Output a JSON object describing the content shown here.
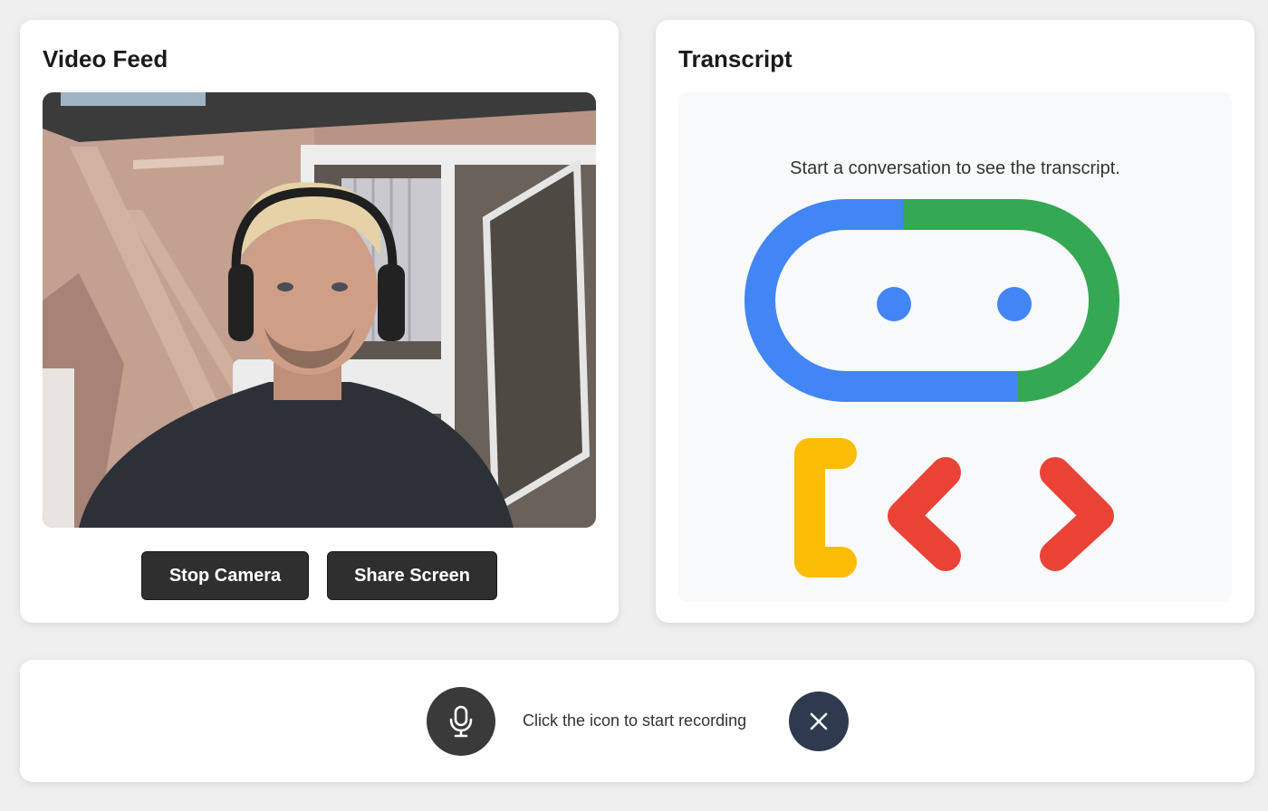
{
  "video": {
    "title": "Video Feed",
    "stop_camera_label": "Stop Camera",
    "share_screen_label": "Share Screen"
  },
  "transcript": {
    "title": "Transcript",
    "placeholder": "Start a conversation to see the transcript."
  },
  "controls": {
    "hint": "Click the icon to start recording",
    "mic_icon": "microphone-icon",
    "close_icon": "close-icon"
  },
  "colors": {
    "blue": "#4285f4",
    "green": "#34a853",
    "yellow": "#fbbc04",
    "red": "#ea4335",
    "button_dark": "#2f2f2f",
    "close_button": "#2e3a4e"
  }
}
